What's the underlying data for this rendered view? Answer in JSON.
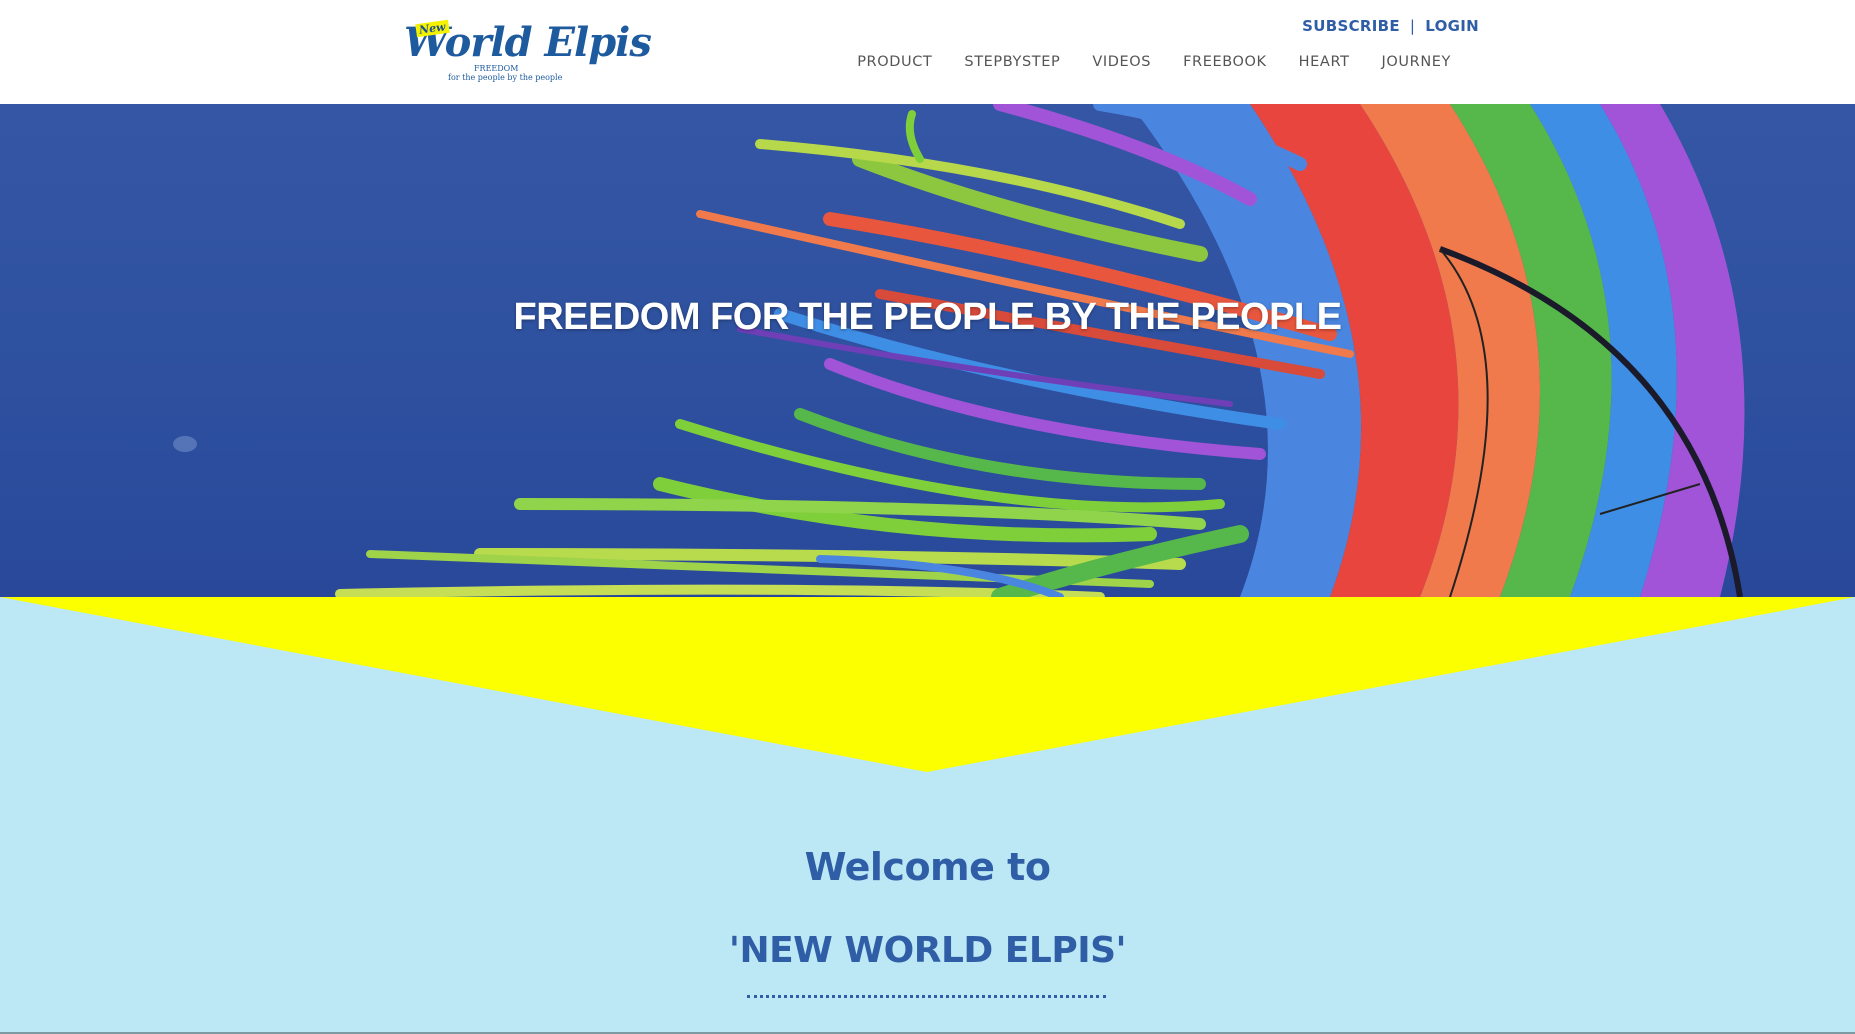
{
  "logo": {
    "badge": "New",
    "name": "World Elpis",
    "tagline_top": "FREEDOM",
    "tagline_bottom": "for the people by the people"
  },
  "header": {
    "util_links": [
      {
        "label": "SUBSCRIBE"
      },
      {
        "label": "LOGIN"
      }
    ],
    "separator": "|",
    "nav": [
      {
        "label": "PRODUCT"
      },
      {
        "label": "STEPBYSTEP"
      },
      {
        "label": "VIDEOS"
      },
      {
        "label": "FREEBOOK"
      },
      {
        "label": "HEART"
      },
      {
        "label": "JOURNEY"
      }
    ]
  },
  "hero": {
    "title": "FREEDOM FOR THE PEOPLE BY THE PEOPLE"
  },
  "welcome": {
    "line1": "Welcome to",
    "line2": "'NEW WORLD ELPIS'"
  },
  "colors": {
    "brand_blue": "#2f5ea6",
    "sky_band": "#bce8f6",
    "chevron_yellow": "#fbff00",
    "hero_blue": "#2f52a0"
  }
}
